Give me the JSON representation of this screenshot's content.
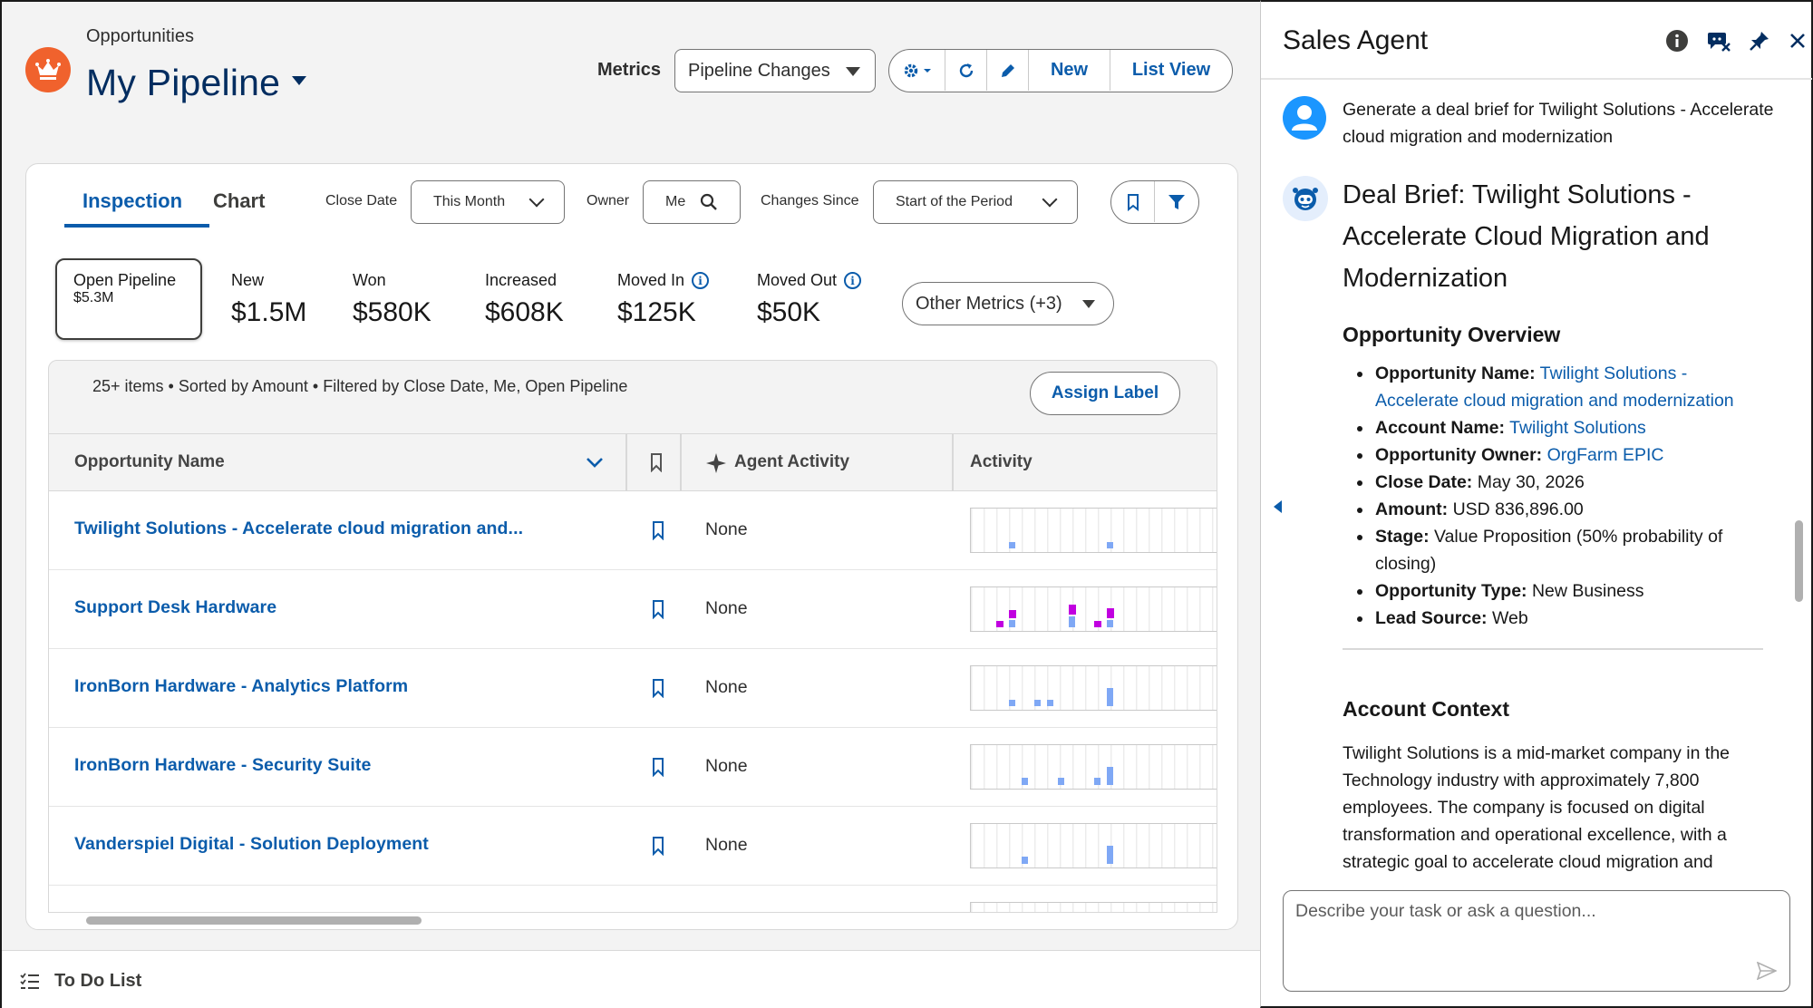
{
  "header": {
    "object_label": "Opportunities",
    "title": "My Pipeline",
    "metrics_label": "Metrics",
    "metrics_select": "Pipeline Changes",
    "new_label": "New",
    "list_view_label": "List View"
  },
  "tabs": {
    "inspection": "Inspection",
    "chart": "Chart"
  },
  "filters": {
    "close_date_label": "Close Date",
    "close_date_value": "This Month",
    "owner_label": "Owner",
    "owner_value": "Me",
    "changes_since_label": "Changes Since",
    "changes_since_value": "Start of the Period"
  },
  "metrics": [
    {
      "label": "Open Pipeline",
      "value": "$5.3M"
    },
    {
      "label": "New",
      "value": "$1.5M"
    },
    {
      "label": "Won",
      "value": "$580K"
    },
    {
      "label": "Increased",
      "value": "$608K"
    },
    {
      "label": "Moved In",
      "value": "$125K"
    },
    {
      "label": "Moved Out",
      "value": "$50K"
    }
  ],
  "other_metrics": "Other Metrics (+3)",
  "list": {
    "info": "25+ items • Sorted by Amount • Filtered by Close Date, Me, Open Pipeline",
    "assign_label": "Assign Label",
    "columns": {
      "name": "Opportunity Name",
      "agent": "Agent Activity",
      "activity": "Activity"
    },
    "rows": [
      {
        "name": "Twilight Solutions - Accelerate cloud migration and...",
        "agent": "None"
      },
      {
        "name": "Support Desk Hardware",
        "agent": "None"
      },
      {
        "name": "IronBorn Hardware - Analytics Platform",
        "agent": "None"
      },
      {
        "name": "IronBorn Hardware - Security Suite",
        "agent": "None"
      },
      {
        "name": "Vanderspiel Digital - Solution Deployment",
        "agent": "None"
      }
    ]
  },
  "todo_label": "To Do List",
  "panel": {
    "title": "Sales Agent",
    "user_message": "Generate a deal brief for Twilight Solutions - Accelerate cloud migration and modernization",
    "brief_title": "Deal Brief: Twilight Solutions - Accelerate Cloud Migration and Modernization",
    "overview_heading": "Opportunity Overview",
    "overview": [
      {
        "key": "Opportunity Name:",
        "value": "Twilight Solutions - Accelerate cloud migration and modernization",
        "link": true
      },
      {
        "key": "Account Name:",
        "value": "Twilight Solutions",
        "link": true
      },
      {
        "key": "Opportunity Owner:",
        "value": "OrgFarm EPIC",
        "link": true
      },
      {
        "key": "Close Date:",
        "value": "May 30, 2026",
        "link": false
      },
      {
        "key": "Amount:",
        "value": "USD 836,896.00",
        "link": false
      },
      {
        "key": "Stage:",
        "value": "Value Proposition (50% probability of closing)",
        "link": false
      },
      {
        "key": "Opportunity Type:",
        "value": "New Business",
        "link": false
      },
      {
        "key": "Lead Source:",
        "value": "Web",
        "link": false
      }
    ],
    "context_heading": "Account Context",
    "context_text": "Twilight Solutions is a mid-market company in the Technology industry with approximately 7,800 employees. The company is focused on digital transformation and operational excellence, with a strategic goal to accelerate cloud migration and",
    "input_placeholder": "Describe your task or ask a question..."
  },
  "colors": {
    "brand": "#0b5cab",
    "title": "#032d60",
    "object_icon": "#f0622d",
    "spark_blue": "#7fa8f5",
    "spark_purple": "#c100e0"
  }
}
